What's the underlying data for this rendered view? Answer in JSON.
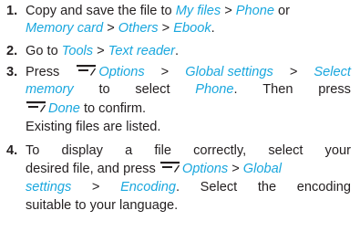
{
  "steps": [
    {
      "number": "1.",
      "lines": [
        {
          "t1": "Copy and save the file to ",
          "l1": "My files",
          "t2": " > ",
          "l2": "Phone",
          "t3": " or"
        },
        {
          "l1": "Memory card",
          "t1": " > ",
          "l2": "Others",
          "t2": " > ",
          "l3": "Ebook",
          "t3": "."
        }
      ]
    },
    {
      "number": "2.",
      "lines": [
        {
          "t1": "Go to ",
          "l1": "Tools",
          "t2": " > ",
          "l2": "Text reader",
          "t3": "."
        }
      ]
    },
    {
      "number": "3.",
      "lines": [
        {
          "t1": "Press",
          "l1": "Options",
          "t2": ">",
          "l2": "Global settings",
          "t3": ">",
          "l3": "Select"
        },
        {
          "l1": "memory",
          "t1": "to",
          "t2": "select",
          "l2": "Phone",
          "t3": "Then",
          "t4": "press"
        },
        {
          "l1": "Done",
          "t1": " to confirm."
        },
        {
          "t1": "Existing files are listed."
        }
      ]
    },
    {
      "number": "4.",
      "lines": [
        {
          "t1": "To",
          "t2": "display",
          "t3": "a",
          "t4": "file",
          "t5": "correctly,",
          "t6": "select",
          "t7": "your"
        },
        {
          "t1": "desired file, and press ",
          "l1": "Options",
          "t2": " > ",
          "l2": "Global"
        },
        {
          "l1": "settings",
          "t1": ">",
          "l2": "Encoding",
          "t2": "Select",
          "t3": "the",
          "t4": "encoding"
        },
        {
          "t1": "suitable to your language."
        }
      ]
    }
  ],
  "icons": {
    "softkey": "left-softkey-icon"
  },
  "colors": {
    "link": "#1aa7de",
    "text": "#231f20"
  }
}
